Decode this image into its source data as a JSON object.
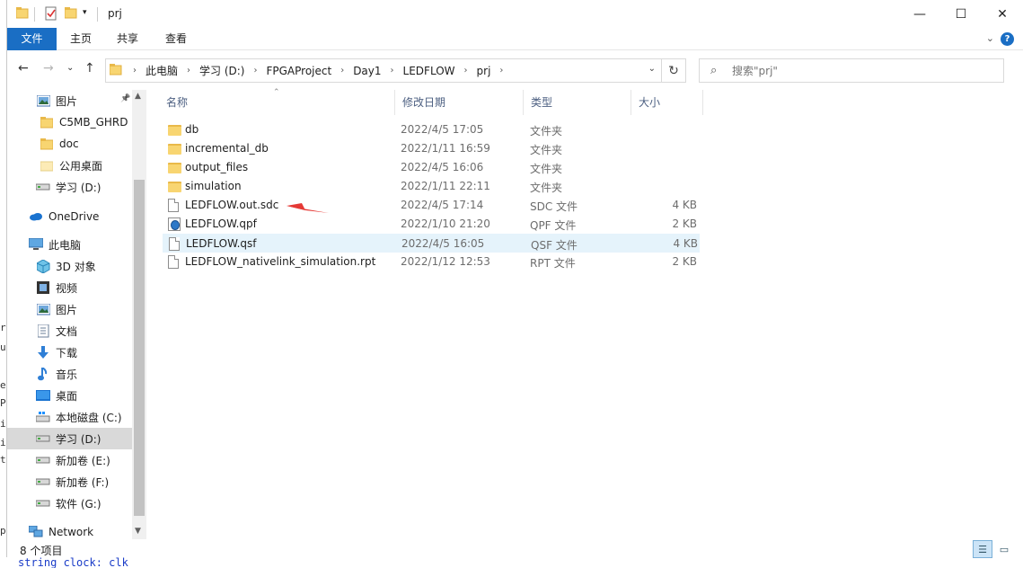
{
  "window": {
    "title": "prj",
    "quick_access_icons": [
      "folder-icon",
      "properties-icon",
      "new-folder-icon",
      "customize-dropdown-icon"
    ],
    "controls": {
      "minimize": "—",
      "maximize": "☐",
      "close": "✕"
    }
  },
  "ribbon": {
    "tabs": [
      {
        "label": "文件",
        "active": true
      },
      {
        "label": "主页"
      },
      {
        "label": "共享"
      },
      {
        "label": "查看"
      }
    ],
    "expand_glyph": "⌄",
    "help_glyph": "?"
  },
  "navigation": {
    "back_glyph": "←",
    "forward_glyph": "→",
    "recent_glyph": "⌄",
    "up_glyph": "↑",
    "breadcrumbs": [
      "此电脑",
      "学习 (D:)",
      "FPGAProject",
      "Day1",
      "LEDFLOW",
      "prj"
    ],
    "refresh_glyph": "↻"
  },
  "search": {
    "placeholder": "搜索\"prj\""
  },
  "sidebar": {
    "items": [
      {
        "label": "图片",
        "icon": "pictures-icon",
        "pinned": true
      },
      {
        "label": "C5MB_GHRD",
        "icon": "folder-icon"
      },
      {
        "label": "doc",
        "icon": "folder-icon"
      },
      {
        "label": "公用桌面",
        "icon": "folder-light-icon"
      },
      {
        "label": "学习 (D:)",
        "icon": "drive-icon"
      },
      {
        "label": "OneDrive",
        "icon": "onedrive-icon"
      },
      {
        "label": "此电脑",
        "icon": "this-pc-icon"
      },
      {
        "label": "3D 对象",
        "icon": "3d-objects-icon"
      },
      {
        "label": "视频",
        "icon": "videos-icon"
      },
      {
        "label": "图片",
        "icon": "pictures-icon"
      },
      {
        "label": "文档",
        "icon": "documents-icon"
      },
      {
        "label": "下载",
        "icon": "downloads-icon"
      },
      {
        "label": "音乐",
        "icon": "music-icon"
      },
      {
        "label": "桌面",
        "icon": "desktop-icon"
      },
      {
        "label": "本地磁盘 (C:)",
        "icon": "system-drive-icon"
      },
      {
        "label": "学习 (D:)",
        "icon": "drive-icon",
        "selected": true
      },
      {
        "label": "新加卷 (E:)",
        "icon": "drive-icon"
      },
      {
        "label": "新加卷 (F:)",
        "icon": "drive-icon"
      },
      {
        "label": "软件 (G:)",
        "icon": "drive-icon"
      },
      {
        "label": "Network",
        "icon": "network-icon"
      }
    ]
  },
  "columns": {
    "name": "名称",
    "modified": "修改日期",
    "type": "类型",
    "size": "大小"
  },
  "files": [
    {
      "name": "db",
      "modified": "2022/4/5 17:05",
      "type": "文件夹",
      "size": "",
      "icon": "folder"
    },
    {
      "name": "incremental_db",
      "modified": "2022/1/11 16:59",
      "type": "文件夹",
      "size": "",
      "icon": "folder"
    },
    {
      "name": "output_files",
      "modified": "2022/4/5 16:06",
      "type": "文件夹",
      "size": "",
      "icon": "folder"
    },
    {
      "name": "simulation",
      "modified": "2022/1/11 22:11",
      "type": "文件夹",
      "size": "",
      "icon": "folder"
    },
    {
      "name": "LEDFLOW.out.sdc",
      "modified": "2022/4/5 17:14",
      "type": "SDC 文件",
      "size": "4 KB",
      "icon": "doc"
    },
    {
      "name": "LEDFLOW.qpf",
      "modified": "2022/1/10 21:20",
      "type": "QPF 文件",
      "size": "2 KB",
      "icon": "qpf"
    },
    {
      "name": "LEDFLOW.qsf",
      "modified": "2022/4/5 16:05",
      "type": "QSF 文件",
      "size": "4 KB",
      "icon": "doc",
      "selected": true
    },
    {
      "name": "LEDFLOW_nativelink_simulation.rpt",
      "modified": "2022/1/12 12:53",
      "type": "RPT 文件",
      "size": "2 KB",
      "icon": "doc"
    }
  ],
  "status": {
    "item_count": "8 个项目"
  },
  "colors": {
    "accent": "#1a6ec4",
    "annotation_arrow": "#e53935",
    "selection": "#e5f3fb",
    "nav_selection": "#d9d9d9"
  },
  "background": {
    "code_fragment": "string clock: clk",
    "edge_letters": [
      "ra",
      "ur",
      "es",
      "Pa",
      "ig",
      "in",
      "to",
      "p"
    ]
  }
}
